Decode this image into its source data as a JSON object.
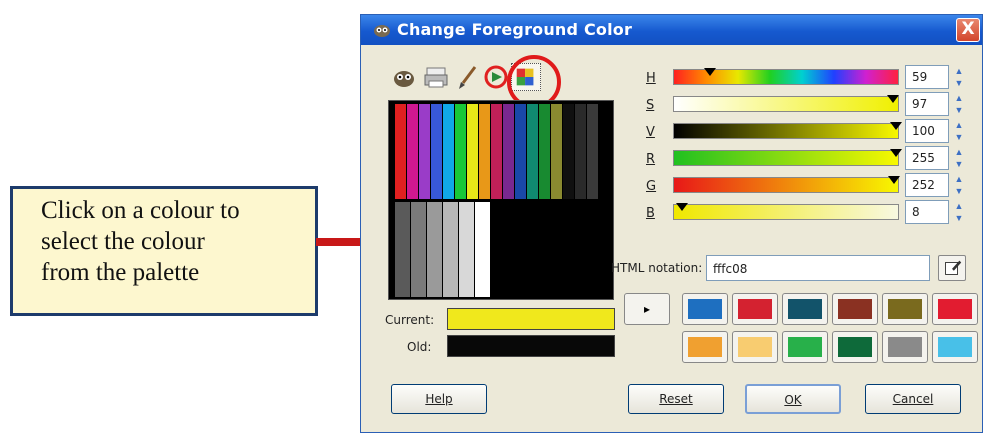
{
  "callout": {
    "lines": [
      "Click on a colour to",
      "select the colour",
      "from the palette"
    ]
  },
  "dialog": {
    "title": "Change Foreground Color",
    "title_icon": "gimp-icon",
    "close_icon": "close-icon",
    "close_label": "X"
  },
  "tools": [
    "gimp-selector-icon",
    "printer-icon",
    "brush-icon",
    "triangle-wheel-icon",
    "palette-icon"
  ],
  "palette": {
    "top_colors": [
      "#e02020",
      "#d01890",
      "#9a3cc8",
      "#3858d8",
      "#10a8e8",
      "#18c838",
      "#e8e818",
      "#e89818",
      "#c02058",
      "#7a2890",
      "#1a48a8",
      "#108a70",
      "#188a30",
      "#8a8a30",
      "#101010",
      "#2a2a2a",
      "#3a3a3a"
    ],
    "grays": [
      "#5a5a5a",
      "#7a7a7a",
      "#9a9a9a",
      "#b8b8b8",
      "#d8d8d8",
      "#ffffff"
    ]
  },
  "current_old": {
    "current_label": "Current:",
    "old_label": "Old:",
    "current_color": "#f0e81c",
    "old_color": "#080808"
  },
  "channels": [
    {
      "label": "H",
      "value": "59"
    },
    {
      "label": "S",
      "value": "97"
    },
    {
      "label": "V",
      "value": "100"
    },
    {
      "label": "R",
      "value": "255"
    },
    {
      "label": "G",
      "value": "252"
    },
    {
      "label": "B",
      "value": "8"
    }
  ],
  "html_notation": {
    "label": "HTML notation:",
    "value": "fffc08",
    "picker_icon": "eyedropper-icon"
  },
  "history": {
    "arrow_label": "▸",
    "colors": [
      "#1e6fc0",
      "#d42230",
      "#12536a",
      "#8a3122",
      "#7a6a1e",
      "#e21c30",
      "#f0a030",
      "#f8cc70",
      "#28b04a",
      "#0e6a3a",
      "#8a8a8a",
      "#48c0e8"
    ]
  },
  "buttons": {
    "help": "Help",
    "reset": "Reset",
    "ok": "OK",
    "cancel": "Cancel"
  }
}
